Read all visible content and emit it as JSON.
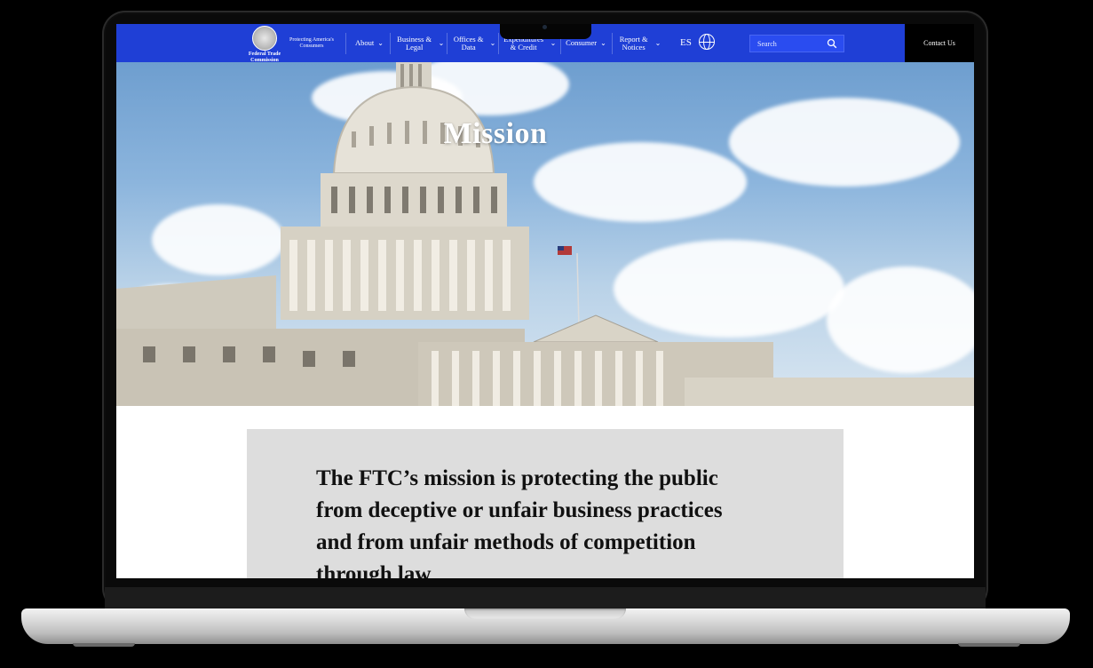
{
  "site": {
    "logo_text": "Federal Trade Commission",
    "tagline": "Protecting America's Consumers"
  },
  "nav": {
    "items": [
      {
        "label": "About"
      },
      {
        "label": "Business & Legal"
      },
      {
        "label": "Offices & Data"
      },
      {
        "label": "Expenditures & Credit"
      },
      {
        "label": "Consumer"
      },
      {
        "label": "Report & Notices"
      }
    ],
    "language": "ES",
    "search_placeholder": "Search",
    "contact": "Contact Us"
  },
  "hero": {
    "title": "Mission"
  },
  "mission": {
    "statement": "The FTC’s mission is protecting the public from deceptive or unfair business practices and from unfair methods of competition through law"
  },
  "colors": {
    "nav_bg": "#1f3fd6",
    "contact_bg": "#000000",
    "mission_box_bg": "#dddddd"
  },
  "icons": [
    "seal-logo-icon",
    "chevron-down-icon",
    "globe-icon",
    "search-icon"
  ]
}
